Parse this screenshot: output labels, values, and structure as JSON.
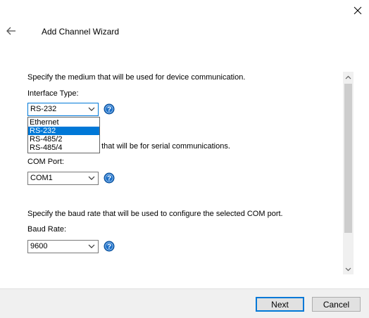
{
  "header": {
    "title": "Add Channel Wizard"
  },
  "interface": {
    "description": "Specify the medium that will be used for device communication.",
    "label": "Interface Type:",
    "selected": "RS-232",
    "options": [
      "Ethernet",
      "RS-232",
      "RS-485/2",
      "RS-485/4"
    ],
    "highlighted_option": "RS-232"
  },
  "com_port": {
    "description_partial": "t that will be for serial communications.",
    "label": "COM Port:",
    "selected": "COM1"
  },
  "baud_rate": {
    "description": "Specify the baud rate that will be used to configure the selected COM port.",
    "label": "Baud Rate:",
    "selected": "9600"
  },
  "footer": {
    "next_label": "Next",
    "cancel_label": "Cancel"
  },
  "icons": {
    "close": "close-icon",
    "back": "back-arrow-icon",
    "help": "help-icon",
    "chevron": "chevron-down-icon"
  },
  "colors": {
    "accent": "#0078d7",
    "help_icon": "#1a6fc9",
    "footer_bg": "#f0f0f0"
  }
}
